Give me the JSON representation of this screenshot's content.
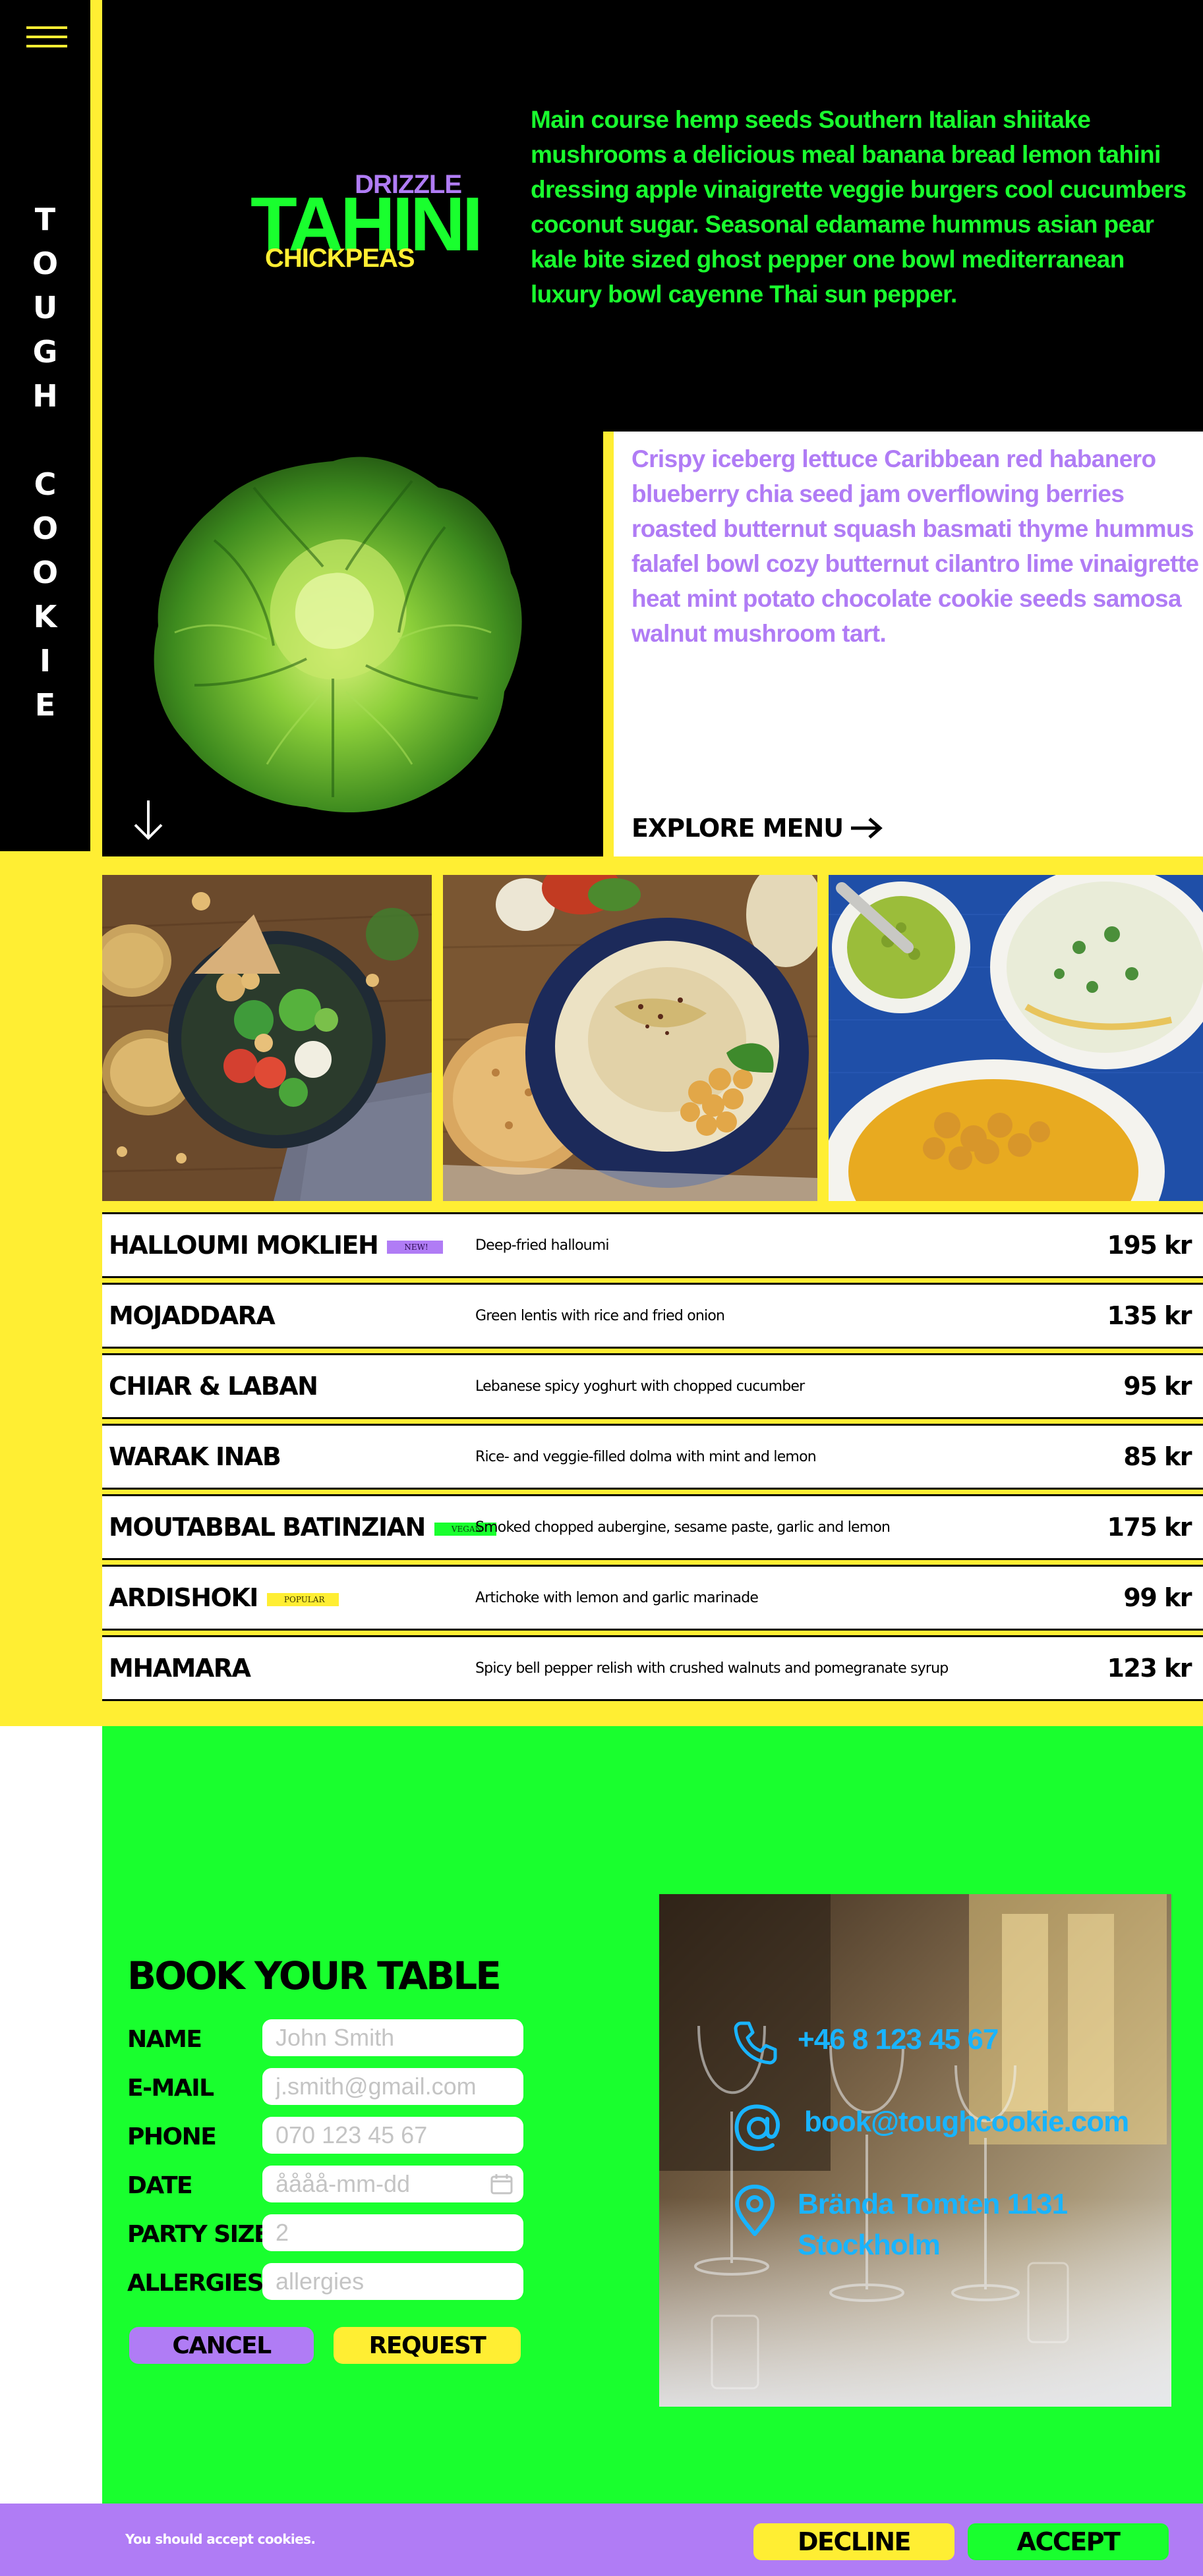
{
  "brand": {
    "vertical_letters": [
      "T",
      "O",
      "U",
      "G",
      "H",
      "",
      "C",
      "O",
      "O",
      "K",
      "I",
      "E"
    ],
    "logo": {
      "top": "DRIZZLE",
      "main": "TAHINI",
      "bottom": "CHICKPEAS"
    }
  },
  "colors": {
    "yellow": "#ffee33",
    "green": "#19ff2e",
    "purple": "#b07cf5",
    "blue": "#19b4ff",
    "black": "#000000"
  },
  "hero": {
    "intro_text": "Main course hemp seeds Southern Italian shiitake mushrooms a delicious meal banana bread lemon tahini dressing apple vinaigrette veggie burgers cool cucumbers coconut sugar. Seasonal edamame hummus asian pear kale bite sized ghost pepper one bowl mediterranean luxury bowl cayenne Thai sun pepper.",
    "side_text": "Crispy iceberg lettuce Caribbean red habanero blueberry chia seed jam overflowing berries roasted butternut squash basmati thyme hummus falafel bowl cozy butternut cilantro lime vinaigrette heat mint potato chocolate cookie seeds samosa walnut mushroom tart.",
    "explore_label": "EXPLORE MENU"
  },
  "menu": {
    "items": [
      {
        "name": "HALLOUMI MOKLIEH",
        "badge": "NEW!",
        "badge_type": "new",
        "description": "Deep-fried halloumi",
        "price": "195 kr"
      },
      {
        "name": "MOJADDARA",
        "badge": "",
        "badge_type": "",
        "description": "Green lentis with rice and fried onion",
        "price": "135 kr"
      },
      {
        "name": "CHIAR & LABAN",
        "badge": "",
        "badge_type": "",
        "description": "Lebanese spicy yoghurt with chopped cucumber",
        "price": "95 kr"
      },
      {
        "name": "WARAK INAB",
        "badge": "",
        "badge_type": "",
        "description": "Rice- and veggie-filled dolma with mint and lemon",
        "price": "85 kr"
      },
      {
        "name": "MOUTABBAL BATINZIAN",
        "badge": "VEGAN",
        "badge_type": "vegan",
        "description": "Smoked chopped aubergine, sesame paste, garlic and lemon",
        "price": "175 kr"
      },
      {
        "name": "ARDISHOKI",
        "badge": "POPULAR",
        "badge_type": "popular",
        "description": "Artichoke with lemon and garlic marinade",
        "price": "99 kr"
      },
      {
        "name": "MHAMARA",
        "badge": "",
        "badge_type": "",
        "description": "Spicy bell pepper relish with crushed walnuts and pomegranate syrup",
        "price": "123 kr"
      }
    ]
  },
  "booking": {
    "title": "BOOK YOUR TABLE",
    "fields": {
      "name": {
        "label": "NAME",
        "placeholder": "John Smith",
        "value": ""
      },
      "email": {
        "label": "E-MAIL",
        "placeholder": "j.smith@gmail.com",
        "value": ""
      },
      "phone": {
        "label": "PHONE",
        "placeholder": "070 123 45 67",
        "value": ""
      },
      "date": {
        "label": "DATE",
        "placeholder": "åååå-mm-dd",
        "value": ""
      },
      "party_size": {
        "label": "PARTY SIZE",
        "placeholder": "2",
        "value": ""
      },
      "allergies": {
        "label": "ALLERGIES",
        "placeholder": "allergies",
        "value": ""
      }
    },
    "cancel_label": "CANCEL",
    "request_label": "REQUEST"
  },
  "contact": {
    "phone": "+46 8 123 45 67",
    "email": "book@toughcookie.com",
    "address_line1": "Brända Tomten 1131",
    "address_line2": "Stockholm",
    "icons": [
      "phone-icon",
      "at-icon",
      "location-pin-icon"
    ]
  },
  "cookie": {
    "message": "You should accept cookies.",
    "decline_label": "DECLINE",
    "accept_label": "ACCEPT"
  }
}
